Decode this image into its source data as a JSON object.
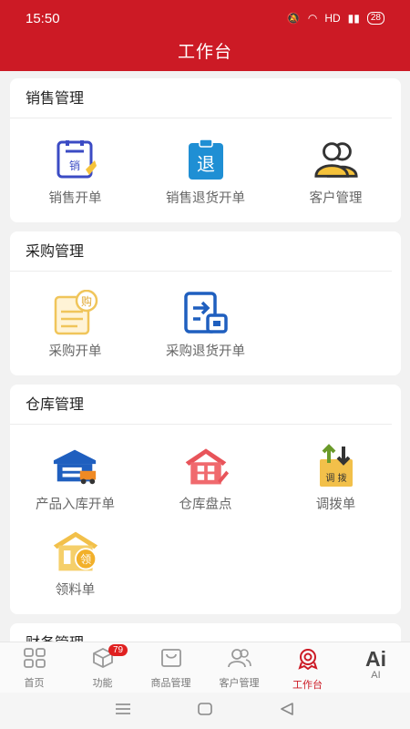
{
  "status": {
    "time": "15:50",
    "network": "HD",
    "battery": "28"
  },
  "header": {
    "title": "工作台"
  },
  "sections": [
    {
      "title": "销售管理",
      "items": [
        {
          "label": "销售开单",
          "icon": "sales-order-icon"
        },
        {
          "label": "销售退货开单",
          "icon": "sales-return-icon",
          "glyph": "退"
        },
        {
          "label": "客户管理",
          "icon": "customer-icon"
        }
      ]
    },
    {
      "title": "采购管理",
      "items": [
        {
          "label": "采购开单",
          "icon": "purchase-order-icon",
          "glyph": "购"
        },
        {
          "label": "采购退货开单",
          "icon": "purchase-return-icon"
        }
      ]
    },
    {
      "title": "仓库管理",
      "items": [
        {
          "label": "产品入库开单",
          "icon": "warehouse-in-icon"
        },
        {
          "label": "仓库盘点",
          "icon": "inventory-check-icon"
        },
        {
          "label": "调拨单",
          "icon": "transfer-icon",
          "glyph": "调 拨"
        },
        {
          "label": "领料单",
          "icon": "material-requisition-icon",
          "glyph": "领"
        }
      ]
    },
    {
      "title": "财务管理",
      "items": []
    }
  ],
  "sales_icon_glyph": "销",
  "tabbar": [
    {
      "label": "首页",
      "icon": "home-grid-icon"
    },
    {
      "label": "功能",
      "icon": "box-icon",
      "badge": "79"
    },
    {
      "label": "商品管理",
      "icon": "product-icon"
    },
    {
      "label": "客户管理",
      "icon": "users-icon"
    },
    {
      "label": "工作台",
      "icon": "workbench-icon",
      "active": true
    },
    {
      "label": "AI",
      "icon": "ai-icon",
      "text": "Ai"
    }
  ],
  "colors": {
    "brand": "#cc1a25"
  }
}
